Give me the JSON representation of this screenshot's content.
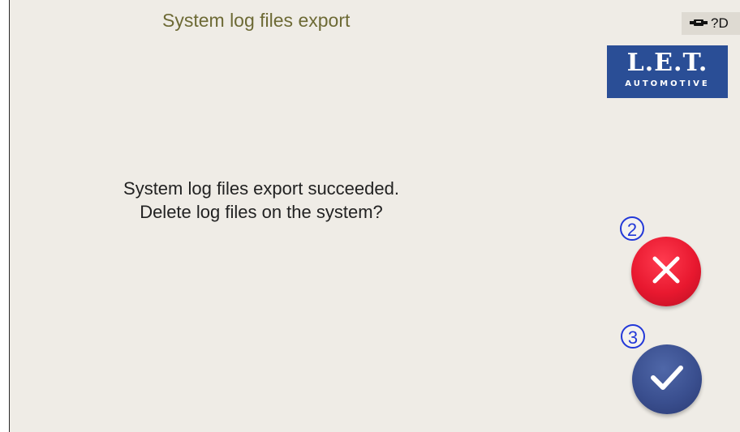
{
  "header": {
    "title": "System log files export"
  },
  "status_tray": {
    "text": "?D",
    "icon": "connector-icon"
  },
  "logo": {
    "brand": "L.E.T.",
    "sub": "AUTOMOTIVE",
    "color": "#2a4e96"
  },
  "dialog": {
    "message_line1": "System log files export succeeded.",
    "message_line2": "Delete log files on the system?"
  },
  "actions": {
    "cancel": {
      "badge": "2",
      "icon": "close-icon",
      "color": "#e8182f"
    },
    "confirm": {
      "badge": "3",
      "icon": "checkmark-icon",
      "color": "#3a4f8f"
    }
  }
}
